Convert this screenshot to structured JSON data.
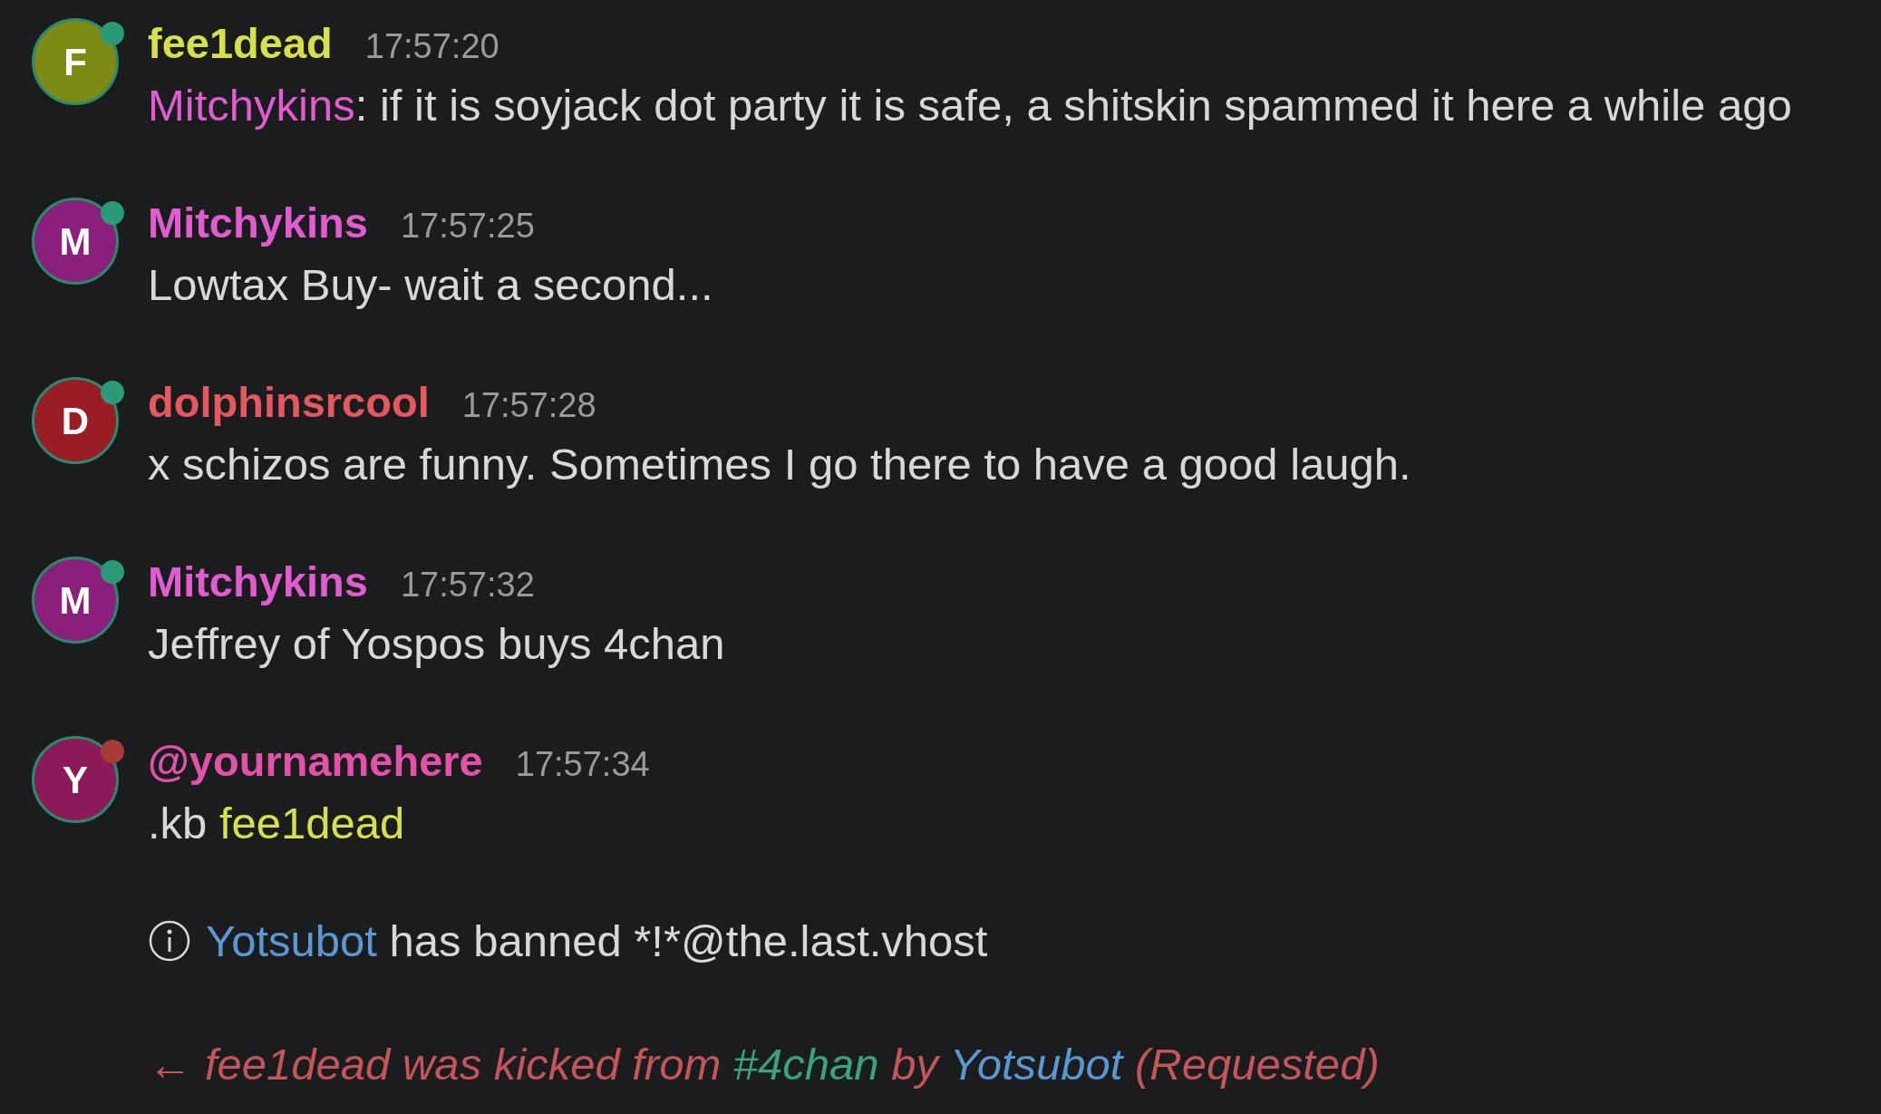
{
  "messages": [
    {
      "avatar": {
        "initial": "F",
        "color": "#7d8a14"
      },
      "status": {
        "color": "#2a9a78"
      },
      "author": {
        "name": "fee1dead",
        "color": "#d6e04a"
      },
      "time": "17:57:20",
      "body": [
        {
          "text": "Mitchykins",
          "color": "#e05ccf"
        },
        {
          "text": ": if it is soyjack dot party it is safe, a shitskin spammed it here a while ago"
        }
      ]
    },
    {
      "avatar": {
        "initial": "M",
        "color": "#8a1f7c"
      },
      "status": {
        "color": "#2a9a78"
      },
      "author": {
        "name": "Mitchykins",
        "color": "#e05ccf"
      },
      "time": "17:57:25",
      "body": [
        {
          "text": "Lowtax Buy- wait a second..."
        }
      ]
    },
    {
      "avatar": {
        "initial": "D",
        "color": "#9a1c25"
      },
      "status": {
        "color": "#2a9a78"
      },
      "author": {
        "name": "dolphinsrcool",
        "color": "#e5585f"
      },
      "time": "17:57:28",
      "body": [
        {
          "text": "x schizos are funny. Sometimes I go there to have a good laugh."
        }
      ]
    },
    {
      "avatar": {
        "initial": "M",
        "color": "#8a1f7c"
      },
      "status": {
        "color": "#2a9a78"
      },
      "author": {
        "name": "Mitchykins",
        "color": "#e05ccf"
      },
      "time": "17:57:32",
      "body": [
        {
          "text": "Jeffrey of Yospos buys 4chan"
        }
      ]
    },
    {
      "avatar": {
        "initial": "Y",
        "color": "#8c1a58"
      },
      "status": {
        "color": "#a83a3a"
      },
      "author": {
        "name": "@yournamehere",
        "color": "#e352a8"
      },
      "time": "17:57:34",
      "body": [
        {
          "text": ".kb "
        },
        {
          "text": "fee1dead",
          "color": "#d6e04a"
        }
      ]
    }
  ],
  "events": [
    {
      "kind": "info",
      "body": [
        {
          "text": "Yotsubot",
          "color": "#5b97d2"
        },
        {
          "text": " has banned *!*@the.last.vhost"
        }
      ]
    },
    {
      "kind": "kick",
      "arrow": "←",
      "body": [
        {
          "text": "fee1dead was kicked from "
        },
        {
          "text": "#4chan",
          "color": "#3aa37d"
        },
        {
          "text": " by "
        },
        {
          "text": "Yotsubot",
          "color": "#5b97d2"
        },
        {
          "text": " (Requested)"
        }
      ]
    }
  ]
}
